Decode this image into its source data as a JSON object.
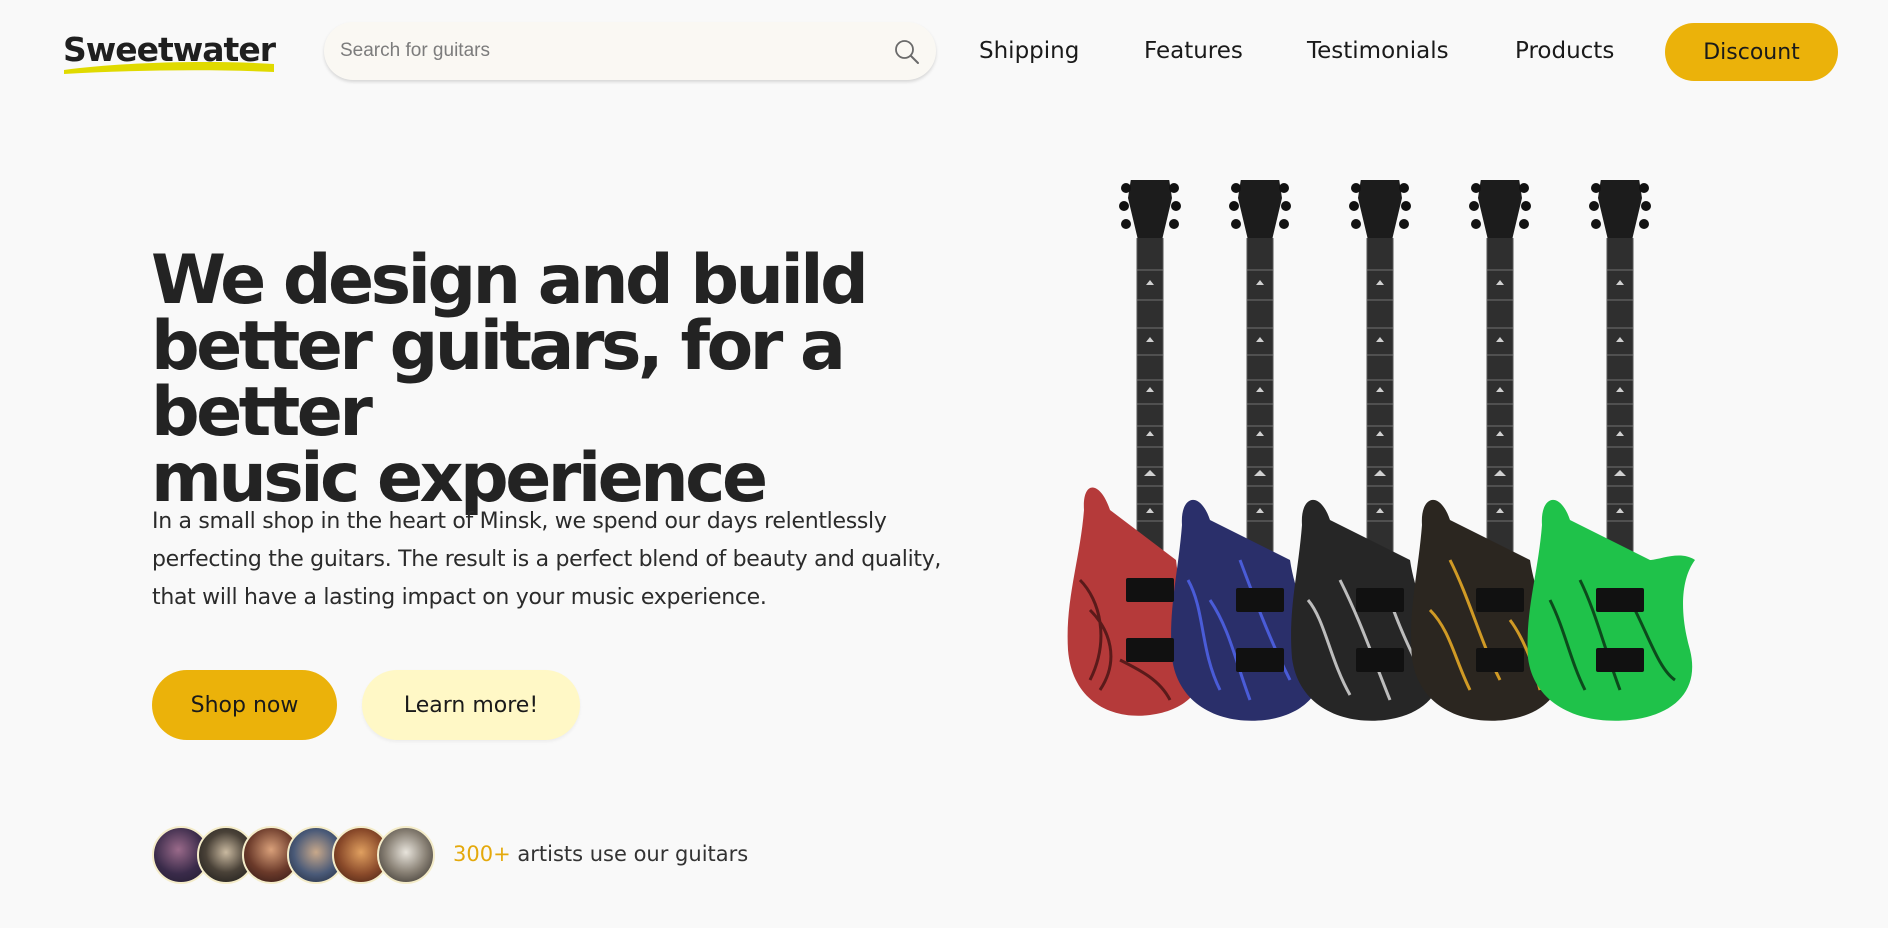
{
  "header": {
    "logo": "Sweetwater",
    "search_placeholder": "Search for guitars",
    "nav": [
      "Shipping",
      "Features",
      "Testimonials",
      "Products"
    ],
    "discount_label": "Discount"
  },
  "hero": {
    "title_lines": [
      "We design and build",
      "better guitars, for a better",
      "music experience"
    ],
    "text_lines": [
      "In a small shop in the heart of Minsk, we spend our days relentlessly",
      "perfecting the guitars. The result is a perfect blend of beauty and quality,",
      "that will have a lasting impact on your music experience."
    ],
    "shop_label": "Shop now",
    "learn_label": "Learn more!"
  },
  "social": {
    "count": "300+",
    "text": "artists use our guitars",
    "avatars": [
      "artist-1",
      "artist-2",
      "artist-3",
      "artist-4",
      "artist-5",
      "artist-6"
    ]
  },
  "guitars": {
    "colors": [
      "#b53a3a",
      "#3a4dc4",
      "#a5a5a5",
      "#d09a25",
      "#1fc24a"
    ]
  },
  "colors": {
    "accent": "#ebb20a",
    "accent_light": "#fff8c6",
    "text_dark": "#232323",
    "background": "#f9f9f9"
  }
}
